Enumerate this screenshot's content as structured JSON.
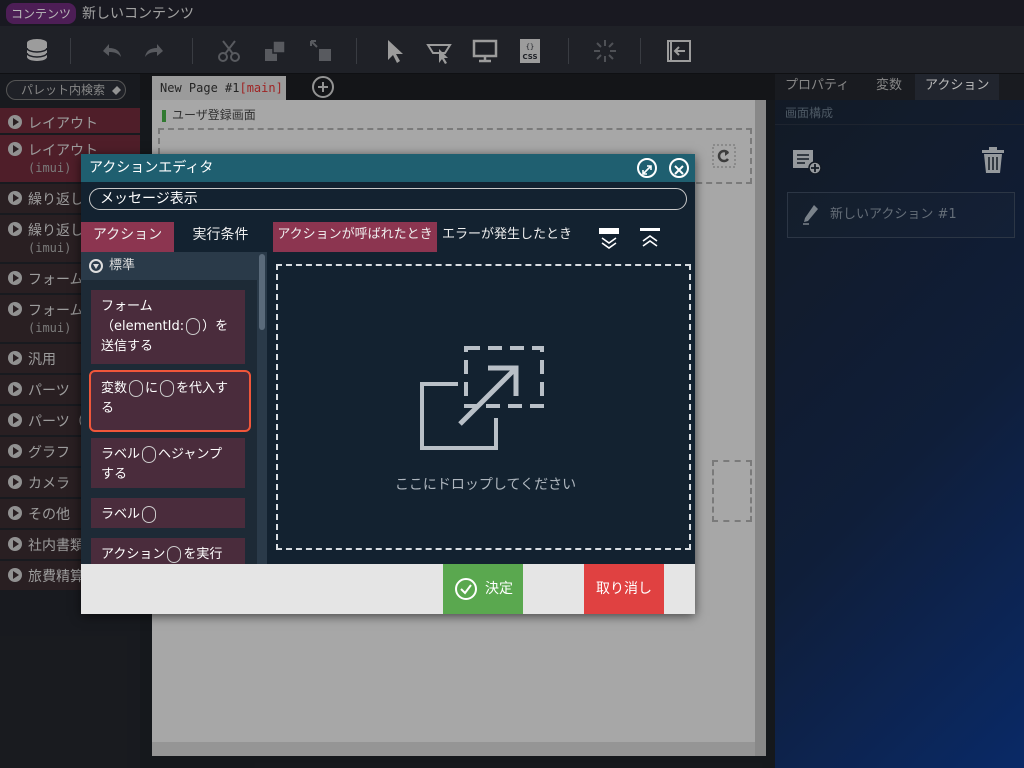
{
  "app": {
    "badge": "コンテンツ",
    "title": "新しいコンテンツ"
  },
  "palette": {
    "search_placeholder": "パレット内検索",
    "items": [
      {
        "label": "レイアウト",
        "sub": ""
      },
      {
        "label": "レイアウト",
        "sub": "(imui)"
      },
      {
        "label": "繰り返し",
        "sub": ""
      },
      {
        "label": "繰り返し",
        "sub": "(imui)"
      },
      {
        "label": "フォーム",
        "sub": ""
      },
      {
        "label": "フォーム",
        "sub": "(imui)"
      },
      {
        "label": "汎用",
        "sub": ""
      },
      {
        "label": "パーツ",
        "sub": ""
      },
      {
        "label": "パーツ（",
        "sub": ""
      },
      {
        "label": "グラフ",
        "sub": ""
      },
      {
        "label": "カメラ",
        "sub": ""
      },
      {
        "label": "その他",
        "sub": ""
      },
      {
        "label": "社内書類",
        "sub": ""
      },
      {
        "label": "旅費精算",
        "sub": ""
      }
    ]
  },
  "page_tab": {
    "name": "New Page #1",
    "suffix": "[main]"
  },
  "canvas": {
    "screen_title": "ユーザ登録画面"
  },
  "right_panel": {
    "tabs": [
      "プロパティ",
      "変数",
      "アクション"
    ],
    "active_tab": "アクション",
    "section": "画面構成",
    "action_item": "新しいアクション #1"
  },
  "modal": {
    "title": "アクションエディタ",
    "message_field": "メッセージ表示",
    "left_tabs": [
      "アクション",
      "実行条件"
    ],
    "event_tabs": [
      "アクションが呼ばれたとき",
      "エラーが発生したとき"
    ],
    "group_label": "標準",
    "cards": [
      {
        "line1": "フォーム",
        "line2_pre": "（elementId:",
        "line2_post": "）を",
        "line3": "送信する"
      },
      {
        "pre": "変数",
        "mid": "に",
        "post": "を代入す",
        "line2": "る"
      },
      {
        "pre": "ラベル",
        "post": "ヘジャンプ",
        "line2": "する"
      },
      {
        "pre": "ラベル",
        "post": ""
      },
      {
        "pre": "アクション",
        "post": "を実行"
      }
    ],
    "drop_text": "ここにドロップしてください",
    "ok_label": "決定",
    "cancel_label": "取り消し"
  },
  "colors": {
    "modal_header": "#1f5f70",
    "tab_active": "#8c3550",
    "card": "#4a2c3c",
    "highlight": "#f0563a",
    "ok": "#5aa84f",
    "cancel": "#e04141"
  }
}
